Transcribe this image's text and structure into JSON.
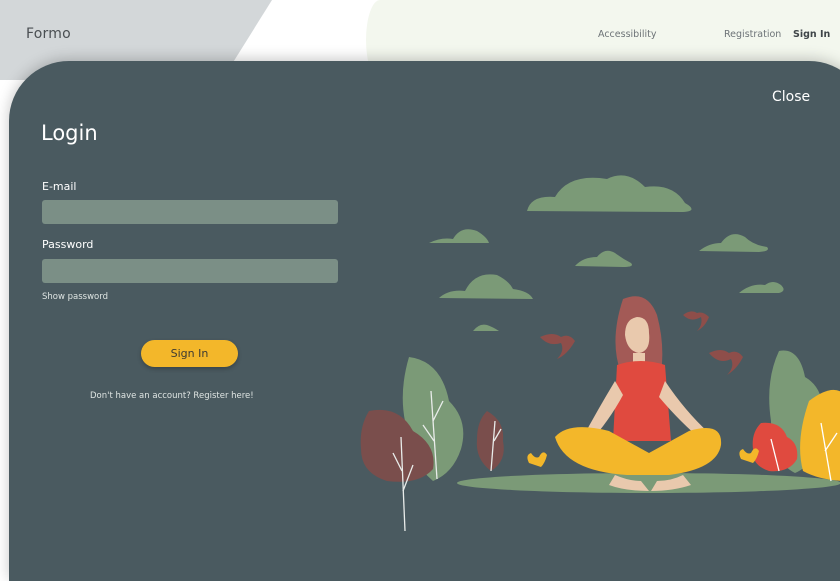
{
  "header": {
    "brand": "Formo",
    "nav": {
      "accessibility": "Accessibility",
      "registration": "Registration",
      "sign_in": "Sign In"
    }
  },
  "modal": {
    "close_label": "Close",
    "title": "Login",
    "email_label": "E-mail",
    "email_value": "",
    "password_label": "Password",
    "password_value": "",
    "show_password": "Show password",
    "submit_label": "Sign In",
    "register_prompt": "Don't have an account? Register here!"
  },
  "colors": {
    "panel": "#4a5a60",
    "field": "#7b8f86",
    "accent": "#f3b72a"
  }
}
